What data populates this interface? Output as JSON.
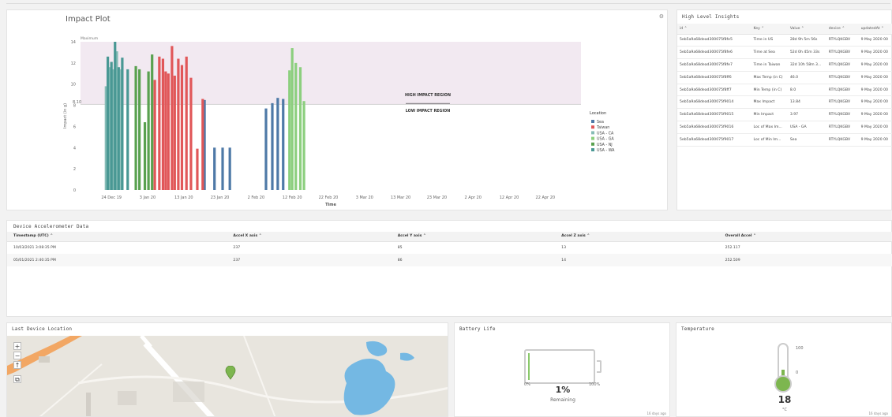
{
  "impact": {
    "title": "Impact Plot",
    "gear_glyph": "⚙",
    "high_label": "HIGH IMPACT REGION",
    "low_label": "LOW IMPACT REGION",
    "max_label": "Maximum",
    "threshold_label": "8.10",
    "legend_title": "Location"
  },
  "chart_data": {
    "type": "bar",
    "title": "Impact Plot",
    "xlabel": "Time",
    "ylabel": "Impact (in g)",
    "ylim": [
      0,
      14
    ],
    "yticks": [
      0,
      2,
      4,
      6,
      8,
      10,
      12,
      14
    ],
    "xticks": [
      "24 Dec 19",
      "3 Jan 20",
      "13 Jan 20",
      "23 Jan 20",
      "2 Feb 20",
      "12 Feb 20",
      "22 Feb 20",
      "3 Mar 20",
      "13 Mar 20",
      "23 Mar 20",
      "2 Apr 20",
      "12 Apr 20",
      "22 Apr 20"
    ],
    "threshold": 8.1,
    "maximum": 14,
    "legend_position": "right",
    "series": [
      {
        "name": "Sea",
        "color": "#4e79a7",
        "bars": [
          [
            11.1,
            8.5
          ],
          [
            12.2,
            4.0
          ],
          [
            13.1,
            4.0
          ],
          [
            13.9,
            4.0
          ],
          [
            17.9,
            7.7
          ],
          [
            18.6,
            8.2
          ],
          [
            19.2,
            8.7
          ],
          [
            19.8,
            8.6
          ]
        ]
      },
      {
        "name": "Taiwan",
        "color": "#e15759",
        "bars": [
          [
            5.6,
            10.4
          ],
          [
            6.1,
            12.6
          ],
          [
            6.5,
            12.4
          ],
          [
            6.8,
            11.2
          ],
          [
            7.1,
            11.0
          ],
          [
            7.5,
            13.6
          ],
          [
            7.8,
            10.8
          ],
          [
            8.2,
            12.4
          ],
          [
            8.6,
            11.8
          ],
          [
            9.1,
            12.6
          ],
          [
            9.6,
            10.6
          ],
          [
            10.3,
            3.9
          ],
          [
            10.9,
            8.6
          ]
        ]
      },
      {
        "name": "USA - CA",
        "color": "#86bcb6",
        "bars": [
          [
            0.2,
            9.8
          ],
          [
            0.6,
            11.6
          ],
          [
            1.0,
            11.4
          ],
          [
            1.4,
            13.1
          ],
          [
            1.9,
            11.4
          ]
        ]
      },
      {
        "name": "USA - GA",
        "color": "#8ccf7e",
        "bars": [
          [
            20.5,
            11.3
          ],
          [
            20.8,
            13.4
          ],
          [
            21.2,
            12.0
          ],
          [
            21.7,
            11.6
          ],
          [
            22.1,
            8.4
          ]
        ]
      },
      {
        "name": "USA - NJ",
        "color": "#59a14f",
        "bars": [
          [
            3.5,
            11.7
          ],
          [
            3.9,
            11.4
          ],
          [
            4.5,
            6.4
          ],
          [
            4.9,
            11.2
          ],
          [
            5.3,
            12.8
          ]
        ]
      },
      {
        "name": "USA - WA",
        "color": "#499894",
        "bars": [
          [
            0.4,
            12.6
          ],
          [
            0.8,
            12.1
          ],
          [
            1.2,
            14.0
          ],
          [
            1.6,
            11.6
          ],
          [
            2.0,
            12.5
          ],
          [
            2.6,
            11.4
          ]
        ]
      }
    ]
  },
  "insights": {
    "title": "High Level Insights",
    "columns": [
      "id ⌃",
      "Key ⌃",
      "Value ⌃",
      "device ⌃",
      "updatedAt ⌃"
    ],
    "rows": [
      [
        "5eb5a9a68dead300075f8fe5",
        "Time in US",
        "28d 9h 5m 56s",
        "RTYLQKGBV",
        "9 May 2020 00"
      ],
      [
        "5eb5a9a68dead300075f8fe6",
        "Time at Sea",
        "52d 0h 45m 33s",
        "RTYLQKGBV",
        "9 May 2020 00"
      ],
      [
        "5eb5a9a68dead300075f8fe7",
        "Time in Taiwan",
        "32d 10h 58m 3...",
        "RTYLQKGBV",
        "9 May 2020 00"
      ],
      [
        "5eb5a9a68dead300075f8ff6",
        "Max Temp (in C)",
        "46.0",
        "RTYLQKGBV",
        "9 May 2020 00"
      ],
      [
        "5eb5a9a68dead300075f8ff7",
        "Min Temp (in C)",
        "8.0",
        "RTYLQKGBV",
        "9 May 2020 00"
      ],
      [
        "5eb5a9a68dead300075f9014",
        "Max Impact",
        "13.84",
        "RTYLQKGBV",
        "9 May 2020 00"
      ],
      [
        "5eb5a9a68dead300075f9015",
        "Min Impact",
        "3.97",
        "RTYLQKGBV",
        "9 May 2020 00"
      ],
      [
        "5eb5a9a68dead300075f9016",
        "Loc of Max Im...",
        "USA - GA",
        "RTYLQKGBV",
        "9 May 2020 00"
      ],
      [
        "5eb5a9a68dead300075f9017",
        "Loc of Min Im...",
        "Sea",
        "RTYLQKGBV",
        "9 May 2020 00"
      ]
    ]
  },
  "accel": {
    "title": "Device Accelerometer Data",
    "columns": [
      "Timestamp (UTC) ⌃",
      "Accel X axis ⌃",
      "Accel Y axis ⌃",
      "Accel Z axis ⌃",
      "Overall Accel ⌃"
    ],
    "rows": [
      [
        "10/03/2021 3:08:35 PM",
        "237",
        "85",
        "13",
        "252.117"
      ],
      [
        "05/01/2021 2:40:35 PM",
        "237",
        "86",
        "14",
        "252.509"
      ]
    ]
  },
  "map": {
    "title": "Last Device Location",
    "zoom_in": "+",
    "zoom_out": "−",
    "north": "↑",
    "layers": "⧉"
  },
  "battery": {
    "title": "Battery Life",
    "level": 0.01,
    "min_label": "0%",
    "max_label": "100%",
    "value": "1%",
    "label": "Remaining",
    "ago": "16 days ago"
  },
  "temperature": {
    "title": "Temperature",
    "max_label": "100",
    "zero_label": "0",
    "value": "18",
    "unit": "°C",
    "ago": "16 days ago"
  }
}
